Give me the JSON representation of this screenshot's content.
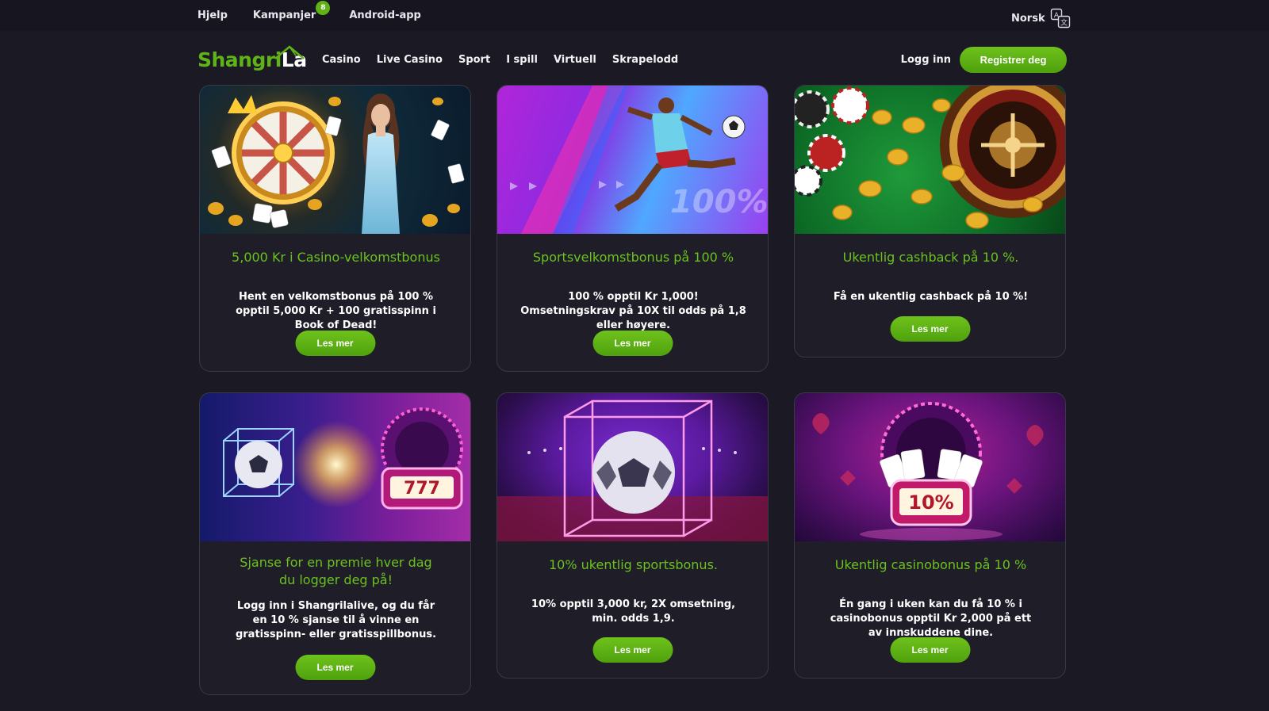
{
  "topbar": {
    "links": [
      "Hjelp",
      "Kampanjer",
      "Android-app"
    ],
    "promo_badge_count": "8",
    "language": "Norsk",
    "language_icon": "translate-icon"
  },
  "nav": {
    "logo_part1": "Shangri",
    "logo_part2": "La",
    "links": [
      "Casino",
      "Live Casino",
      "Sport",
      "I spill",
      "Virtuell",
      "Skrapelodd"
    ],
    "login_label": "Logg inn",
    "register_label": "Registrer deg"
  },
  "colors": {
    "background": "#1b1a24",
    "accent_green": "#5fb317",
    "title_green": "#6bc21f"
  },
  "promotions": [
    {
      "title": "5,000 Kr i Casino-velkomstbonus",
      "description": "Hent en velkomstbonus på 100 % opptil 5,000 Kr + 100 gratisspinn i Book of Dead!",
      "button": "Les mer"
    },
    {
      "title": "Sportsvelkomstbonus på 100 %",
      "description": "100 % opptil Kr 1,000! Omsetningskrav på 10X til odds på 1,8 eller høyere.",
      "button": "Les mer"
    },
    {
      "title": "Ukentlig cashback på 10 %.",
      "description": "Få en ukentlig cashback på 10 %!",
      "button": "Les mer"
    },
    {
      "title": "Sjanse for en premie hver dag du logger deg på!",
      "description": "Logg inn i Shangrilalive, og du får en 10 % sjanse til å vinne en gratisspinn- eller gratisspillbonus.",
      "button": "Les mer"
    },
    {
      "title": "10% ukentlig sportsbonus.",
      "description": "10% opptil 3,000 kr, 2X omsetning, min. odds 1,9.",
      "button": "Les mer"
    },
    {
      "title": "Ukentlig casinobonus på 10 %",
      "description": "Én gang i uken kan du få 10 % i casinobonus opptil Kr 2,000 på ett av innskuddene dine.",
      "button": "Les mer"
    }
  ],
  "image_labels": {
    "sport_banner_text": "100%",
    "slot_reels": "777",
    "slot_percent": "10%"
  }
}
